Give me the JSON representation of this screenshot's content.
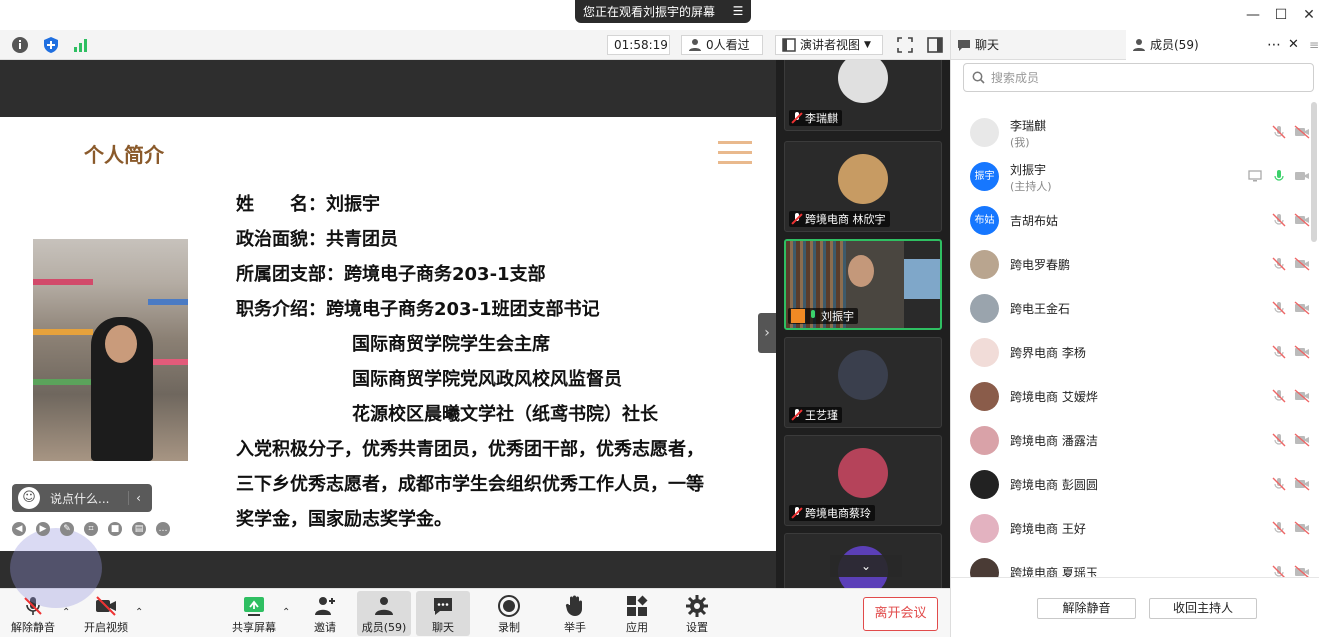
{
  "titlebar": {
    "share_notice": "您正在观看刘振宇的屏幕"
  },
  "toolbar": {
    "timer": "01:58:19",
    "viewers": "0人看过",
    "view_mode": "演讲者视图"
  },
  "slide": {
    "title": "个人简介",
    "bio_lines": [
      "姓　　名：刘振宇",
      "政治面貌：共青团员",
      "所属团支部：跨境电子商务203-1支部",
      "职务介绍：跨境电子商务203-1班团支部书记"
    ],
    "bio_indented": [
      "国际商贸学院学生会主席",
      "国际商贸学院党风政风校风监督员",
      "花源校区晨曦文学社（纸鸢书院）社长"
    ],
    "bio_wide": [
      "入党积极分子，优秀共青团员，优秀团干部，优秀志愿者，",
      "三下乡优秀志愿者，成都市学生会组织优秀工作人员，一等",
      "奖学金，国家励志奖学金。"
    ],
    "chat_placeholder": "说点什么..."
  },
  "video_tiles": [
    {
      "name": "李瑞麒",
      "mic": "off",
      "color": "#d9d9d9"
    },
    {
      "name": "跨境电商 林欣宇",
      "mic": "off",
      "color": "#c79b63"
    },
    {
      "name": "刘振宇",
      "mic": "on",
      "color": "#6b5a44"
    },
    {
      "name": "王艺瑾",
      "mic": "off",
      "color": "#3a3f4d"
    },
    {
      "name": "跨境电商蔡玲",
      "mic": "off",
      "color": "#b5435a"
    }
  ],
  "bottombar": {
    "unmute": "解除静音",
    "start_video": "开启视频",
    "share_screen": "共享屏幕",
    "invite": "邀请",
    "members": "成员(59)",
    "chat": "聊天",
    "record": "录制",
    "raise_hand": "举手",
    "apps": "应用",
    "settings": "设置",
    "leave": "离开会议"
  },
  "rpanel": {
    "tab_chat": "聊天",
    "tab_members": "成员(59)",
    "search_placeholder": "搜索成员",
    "members": [
      {
        "name": "李瑞麒",
        "sub": "(我)",
        "avatar_text": "",
        "color": "#e8e8e8",
        "mic": "off"
      },
      {
        "name": "刘振宇",
        "sub": "(主持人)",
        "avatar_text": "振宇",
        "color": "#1677ff",
        "mic": "on"
      },
      {
        "name": "吉胡布姑",
        "sub": "",
        "avatar_text": "布姑",
        "color": "#1677ff",
        "mic": "off"
      },
      {
        "name": "跨电罗春鹏",
        "sub": "",
        "avatar_text": "",
        "color": "#b9a58f",
        "mic": "off"
      },
      {
        "name": "跨电王金石",
        "sub": "",
        "avatar_text": "",
        "color": "#9aa4ad",
        "mic": "off"
      },
      {
        "name": "跨界电商 李杨",
        "sub": "",
        "avatar_text": "",
        "color": "#f1dcd8",
        "mic": "off"
      },
      {
        "name": "跨境电商 艾嫒烨",
        "sub": "",
        "avatar_text": "",
        "color": "#8a5c4a",
        "mic": "off"
      },
      {
        "name": "跨境电商 潘露洁",
        "sub": "",
        "avatar_text": "",
        "color": "#d9a2a8",
        "mic": "off"
      },
      {
        "name": "跨境电商 彭圆圆",
        "sub": "",
        "avatar_text": "",
        "color": "#222222",
        "mic": "off"
      },
      {
        "name": "跨境电商 王好",
        "sub": "",
        "avatar_text": "",
        "color": "#e3b2c0",
        "mic": "off"
      },
      {
        "name": "跨境电商 夏瑶玉",
        "sub": "",
        "avatar_text": "",
        "color": "#4a3b35",
        "mic": "off"
      }
    ],
    "unmute_all": "解除静音",
    "reclaim_host": "收回主持人"
  }
}
